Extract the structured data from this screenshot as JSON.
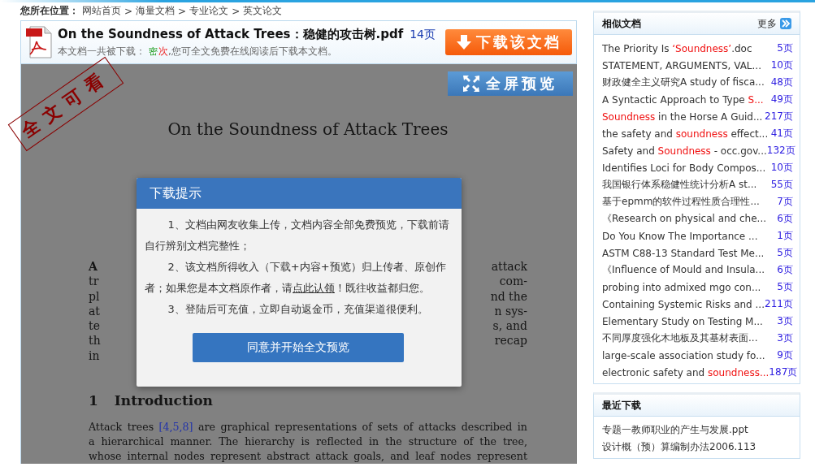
{
  "breadcrumb": {
    "label": "您所在位置：",
    "separator": ">",
    "items": [
      "网站首页",
      "海量文档",
      "专业论文",
      "英文论文"
    ]
  },
  "document": {
    "title": "On the Soundness of Attack Trees：稳健的攻击树.pdf",
    "pages": "14页",
    "download_prefix": "本文档一共被下载：",
    "download_count": "密",
    "download_unit": "次",
    "download_suffix": ",您可全文免费在线阅读后下载本文档。",
    "download_button": "下载该文档",
    "fullscreen_button": "全屏预览",
    "stamp": "全文可看"
  },
  "paper": {
    "title": "On the Soundness of Attack Trees",
    "abstract_fragments": [
      {
        "left": "A",
        "right": "attack"
      },
      {
        "left": "tr",
        "right": "com-"
      },
      {
        "left": "pl",
        "right": "nd the"
      },
      {
        "left": "at",
        "right": "n sys-"
      },
      {
        "left": "te",
        "right": "s, and"
      },
      {
        "left": "th",
        "right": "recap"
      },
      {
        "left": "in"
      }
    ],
    "section_number": "1",
    "section_title": "Introduction",
    "lines": [
      [
        {
          "text": "Attack trees ",
          "link": false
        },
        {
          "text": "[4,5,8]",
          "link": true
        },
        {
          "text": " are graphical representations of sets of attacks described in",
          "link": false
        }
      ],
      [
        {
          "text": "a hierarchical manner. The hierarchy is reflected in the structure of the tree,",
          "link": false
        }
      ],
      [
        {
          "text": "whose internal nodes represent abstract attack goals, and leaf nodes represent",
          "link": false
        }
      ]
    ]
  },
  "dialog": {
    "title": "下载提示",
    "paragraphs": [
      [
        {
          "text": "1、文档由网友收集上传，文档内容全部免费预览，下载前请自行辨别文档完整性；",
          "link": false
        }
      ],
      [
        {
          "text": "2、该文档所得收入（下载+内容+预览）归上传者、原创作者；如果您是本文档原作者，请",
          "link": false
        },
        {
          "text": "点此认领",
          "link": true
        },
        {
          "text": "！既往收益都归您。",
          "link": false
        }
      ],
      [
        {
          "text": "3、登陆后可充值，立即自动返金币，充值渠道很便利。",
          "link": false
        }
      ]
    ],
    "button": "同意并开始全文预览"
  },
  "similar": {
    "title": "相似文档",
    "more": "更多",
    "items": [
      {
        "parts": [
          {
            "text": "The Priority Is ",
            "highlight": false
          },
          {
            "text": "‘Soundness’",
            "highlight": true
          },
          {
            "text": ".doc",
            "highlight": false
          }
        ],
        "pages": "5页"
      },
      {
        "parts": [
          {
            "text": "STATEMENT, ARGUMENTS, VAL...",
            "highlight": false
          }
        ],
        "pages": "10页"
      },
      {
        "parts": [
          {
            "text": "财政健全主义研究A study of fisca...",
            "highlight": false
          }
        ],
        "pages": "48页"
      },
      {
        "parts": [
          {
            "text": "A Syntactic Approach to Type ",
            "highlight": false
          },
          {
            "text": "S...",
            "highlight": true
          }
        ],
        "pages": "49页"
      },
      {
        "parts": [
          {
            "text": "Soundness",
            "highlight": true
          },
          {
            "text": " in the Horse A Guid...",
            "highlight": false
          }
        ],
        "pages": "217页"
      },
      {
        "parts": [
          {
            "text": "the safety and ",
            "highlight": false
          },
          {
            "text": "soundness",
            "highlight": true
          },
          {
            "text": " effect...",
            "highlight": false
          }
        ],
        "pages": "41页"
      },
      {
        "parts": [
          {
            "text": "Safety and ",
            "highlight": false
          },
          {
            "text": "Soundness",
            "highlight": true
          },
          {
            "text": " - occ.gov...",
            "highlight": false
          }
        ],
        "pages": "132页"
      },
      {
        "parts": [
          {
            "text": "Identifies Loci for Body Compos...",
            "highlight": false
          }
        ],
        "pages": "10页"
      },
      {
        "parts": [
          {
            "text": "我国银行体系稳健性统计分析A st...",
            "highlight": false
          }
        ],
        "pages": "55页"
      },
      {
        "parts": [
          {
            "text": "基于epmm的软件过程性质合理性...",
            "highlight": false
          }
        ],
        "pages": "7页"
      },
      {
        "parts": [
          {
            "text": "《Research on physical and che...",
            "highlight": false
          }
        ],
        "pages": "6页"
      },
      {
        "parts": [
          {
            "text": "Do You Know The Importance ...",
            "highlight": false
          }
        ],
        "pages": "1页"
      },
      {
        "parts": [
          {
            "text": "ASTM C88-13 Standard Test Me...",
            "highlight": false
          }
        ],
        "pages": "5页"
      },
      {
        "parts": [
          {
            "text": "《Influence of Mould and Insula...",
            "highlight": false
          }
        ],
        "pages": "6页"
      },
      {
        "parts": [
          {
            "text": "probing into admixed mgo con...",
            "highlight": false
          }
        ],
        "pages": "5页"
      },
      {
        "parts": [
          {
            "text": "Containing Systemic Risks and ...",
            "highlight": false
          }
        ],
        "pages": "211页"
      },
      {
        "parts": [
          {
            "text": "Elementary Study on Testing M...",
            "highlight": false
          }
        ],
        "pages": "3页"
      },
      {
        "parts": [
          {
            "text": "不同厚度强化木地板及其基材表面...",
            "highlight": false
          }
        ],
        "pages": "3页"
      },
      {
        "parts": [
          {
            "text": "large-scale association study fo...",
            "highlight": false
          }
        ],
        "pages": "9页"
      },
      {
        "parts": [
          {
            "text": "electronic safety and ",
            "highlight": false
          },
          {
            "text": "soundness...",
            "highlight": true
          }
        ],
        "pages": "187页"
      }
    ]
  },
  "recent": {
    "title": "最近下载",
    "items": [
      "专题一教师职业的产生与发展.ppt",
      "设计概（预）算编制办法2006.113"
    ]
  }
}
